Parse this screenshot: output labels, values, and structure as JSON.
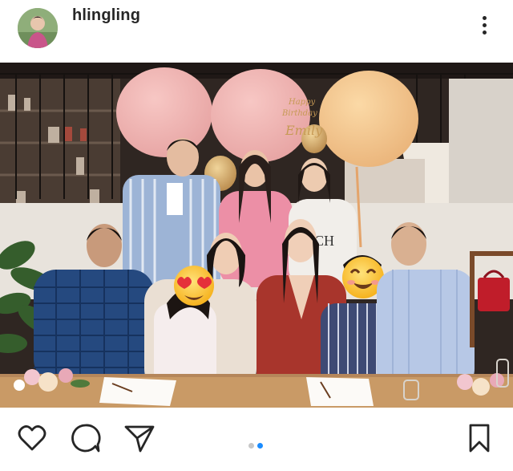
{
  "post": {
    "username": "hlingling"
  },
  "carousel": {
    "active_color": "#1a8cff",
    "inactive_color": "#c7c7c7"
  },
  "photo": {
    "balloon_text": [
      "Happy",
      "Birthday",
      "Emily"
    ]
  },
  "icons": {
    "more": "more-options-icon",
    "like": "heart-icon",
    "comment": "comment-icon",
    "share": "paper-plane-icon",
    "save": "bookmark-icon"
  }
}
